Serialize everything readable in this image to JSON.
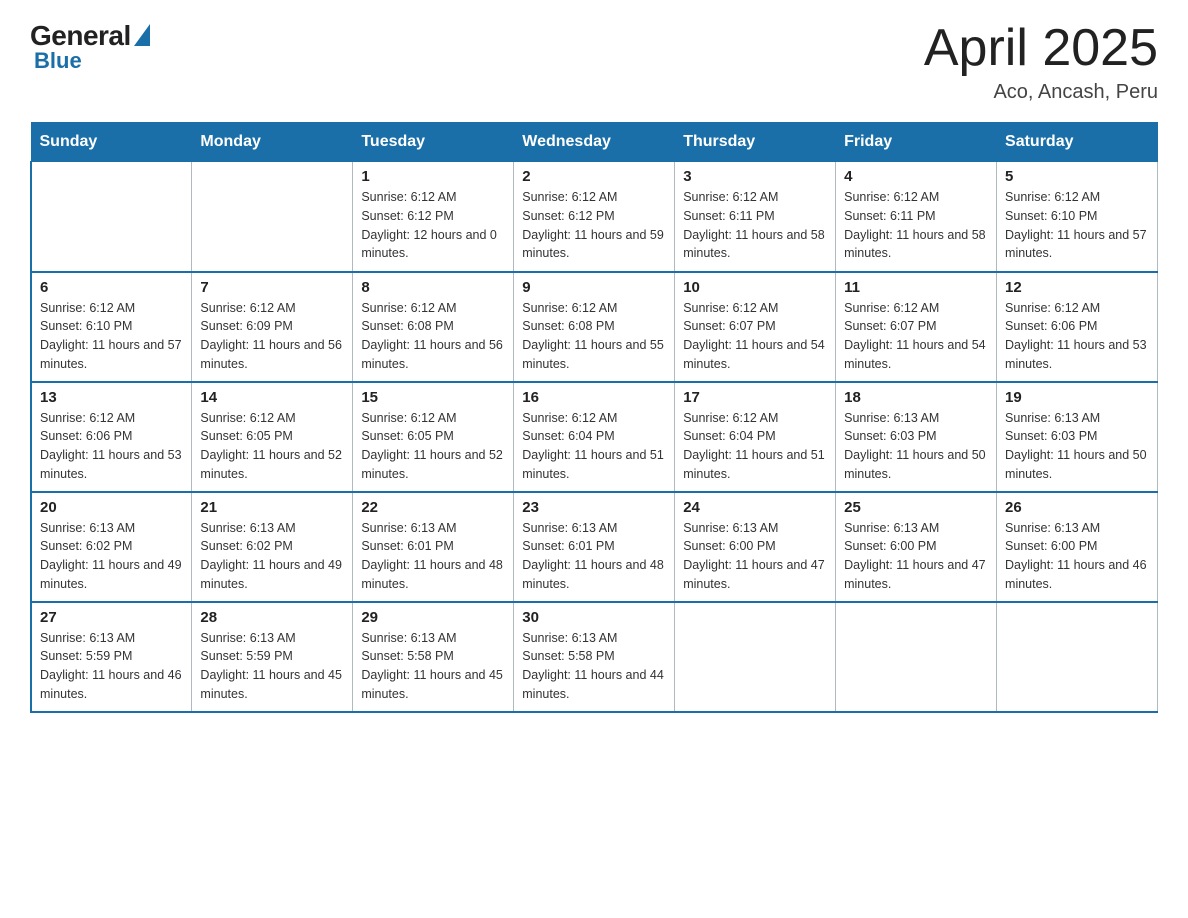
{
  "logo": {
    "general": "General",
    "blue": "Blue"
  },
  "header": {
    "title": "April 2025",
    "subtitle": "Aco, Ancash, Peru"
  },
  "days_of_week": [
    "Sunday",
    "Monday",
    "Tuesday",
    "Wednesday",
    "Thursday",
    "Friday",
    "Saturday"
  ],
  "weeks": [
    [
      {
        "day": "",
        "sunrise": "",
        "sunset": "",
        "daylight": ""
      },
      {
        "day": "",
        "sunrise": "",
        "sunset": "",
        "daylight": ""
      },
      {
        "day": "1",
        "sunrise": "Sunrise: 6:12 AM",
        "sunset": "Sunset: 6:12 PM",
        "daylight": "Daylight: 12 hours and 0 minutes."
      },
      {
        "day": "2",
        "sunrise": "Sunrise: 6:12 AM",
        "sunset": "Sunset: 6:12 PM",
        "daylight": "Daylight: 11 hours and 59 minutes."
      },
      {
        "day": "3",
        "sunrise": "Sunrise: 6:12 AM",
        "sunset": "Sunset: 6:11 PM",
        "daylight": "Daylight: 11 hours and 58 minutes."
      },
      {
        "day": "4",
        "sunrise": "Sunrise: 6:12 AM",
        "sunset": "Sunset: 6:11 PM",
        "daylight": "Daylight: 11 hours and 58 minutes."
      },
      {
        "day": "5",
        "sunrise": "Sunrise: 6:12 AM",
        "sunset": "Sunset: 6:10 PM",
        "daylight": "Daylight: 11 hours and 57 minutes."
      }
    ],
    [
      {
        "day": "6",
        "sunrise": "Sunrise: 6:12 AM",
        "sunset": "Sunset: 6:10 PM",
        "daylight": "Daylight: 11 hours and 57 minutes."
      },
      {
        "day": "7",
        "sunrise": "Sunrise: 6:12 AM",
        "sunset": "Sunset: 6:09 PM",
        "daylight": "Daylight: 11 hours and 56 minutes."
      },
      {
        "day": "8",
        "sunrise": "Sunrise: 6:12 AM",
        "sunset": "Sunset: 6:08 PM",
        "daylight": "Daylight: 11 hours and 56 minutes."
      },
      {
        "day": "9",
        "sunrise": "Sunrise: 6:12 AM",
        "sunset": "Sunset: 6:08 PM",
        "daylight": "Daylight: 11 hours and 55 minutes."
      },
      {
        "day": "10",
        "sunrise": "Sunrise: 6:12 AM",
        "sunset": "Sunset: 6:07 PM",
        "daylight": "Daylight: 11 hours and 54 minutes."
      },
      {
        "day": "11",
        "sunrise": "Sunrise: 6:12 AM",
        "sunset": "Sunset: 6:07 PM",
        "daylight": "Daylight: 11 hours and 54 minutes."
      },
      {
        "day": "12",
        "sunrise": "Sunrise: 6:12 AM",
        "sunset": "Sunset: 6:06 PM",
        "daylight": "Daylight: 11 hours and 53 minutes."
      }
    ],
    [
      {
        "day": "13",
        "sunrise": "Sunrise: 6:12 AM",
        "sunset": "Sunset: 6:06 PM",
        "daylight": "Daylight: 11 hours and 53 minutes."
      },
      {
        "day": "14",
        "sunrise": "Sunrise: 6:12 AM",
        "sunset": "Sunset: 6:05 PM",
        "daylight": "Daylight: 11 hours and 52 minutes."
      },
      {
        "day": "15",
        "sunrise": "Sunrise: 6:12 AM",
        "sunset": "Sunset: 6:05 PM",
        "daylight": "Daylight: 11 hours and 52 minutes."
      },
      {
        "day": "16",
        "sunrise": "Sunrise: 6:12 AM",
        "sunset": "Sunset: 6:04 PM",
        "daylight": "Daylight: 11 hours and 51 minutes."
      },
      {
        "day": "17",
        "sunrise": "Sunrise: 6:12 AM",
        "sunset": "Sunset: 6:04 PM",
        "daylight": "Daylight: 11 hours and 51 minutes."
      },
      {
        "day": "18",
        "sunrise": "Sunrise: 6:13 AM",
        "sunset": "Sunset: 6:03 PM",
        "daylight": "Daylight: 11 hours and 50 minutes."
      },
      {
        "day": "19",
        "sunrise": "Sunrise: 6:13 AM",
        "sunset": "Sunset: 6:03 PM",
        "daylight": "Daylight: 11 hours and 50 minutes."
      }
    ],
    [
      {
        "day": "20",
        "sunrise": "Sunrise: 6:13 AM",
        "sunset": "Sunset: 6:02 PM",
        "daylight": "Daylight: 11 hours and 49 minutes."
      },
      {
        "day": "21",
        "sunrise": "Sunrise: 6:13 AM",
        "sunset": "Sunset: 6:02 PM",
        "daylight": "Daylight: 11 hours and 49 minutes."
      },
      {
        "day": "22",
        "sunrise": "Sunrise: 6:13 AM",
        "sunset": "Sunset: 6:01 PM",
        "daylight": "Daylight: 11 hours and 48 minutes."
      },
      {
        "day": "23",
        "sunrise": "Sunrise: 6:13 AM",
        "sunset": "Sunset: 6:01 PM",
        "daylight": "Daylight: 11 hours and 48 minutes."
      },
      {
        "day": "24",
        "sunrise": "Sunrise: 6:13 AM",
        "sunset": "Sunset: 6:00 PM",
        "daylight": "Daylight: 11 hours and 47 minutes."
      },
      {
        "day": "25",
        "sunrise": "Sunrise: 6:13 AM",
        "sunset": "Sunset: 6:00 PM",
        "daylight": "Daylight: 11 hours and 47 minutes."
      },
      {
        "day": "26",
        "sunrise": "Sunrise: 6:13 AM",
        "sunset": "Sunset: 6:00 PM",
        "daylight": "Daylight: 11 hours and 46 minutes."
      }
    ],
    [
      {
        "day": "27",
        "sunrise": "Sunrise: 6:13 AM",
        "sunset": "Sunset: 5:59 PM",
        "daylight": "Daylight: 11 hours and 46 minutes."
      },
      {
        "day": "28",
        "sunrise": "Sunrise: 6:13 AM",
        "sunset": "Sunset: 5:59 PM",
        "daylight": "Daylight: 11 hours and 45 minutes."
      },
      {
        "day": "29",
        "sunrise": "Sunrise: 6:13 AM",
        "sunset": "Sunset: 5:58 PM",
        "daylight": "Daylight: 11 hours and 45 minutes."
      },
      {
        "day": "30",
        "sunrise": "Sunrise: 6:13 AM",
        "sunset": "Sunset: 5:58 PM",
        "daylight": "Daylight: 11 hours and 44 minutes."
      },
      {
        "day": "",
        "sunrise": "",
        "sunset": "",
        "daylight": ""
      },
      {
        "day": "",
        "sunrise": "",
        "sunset": "",
        "daylight": ""
      },
      {
        "day": "",
        "sunrise": "",
        "sunset": "",
        "daylight": ""
      }
    ]
  ]
}
